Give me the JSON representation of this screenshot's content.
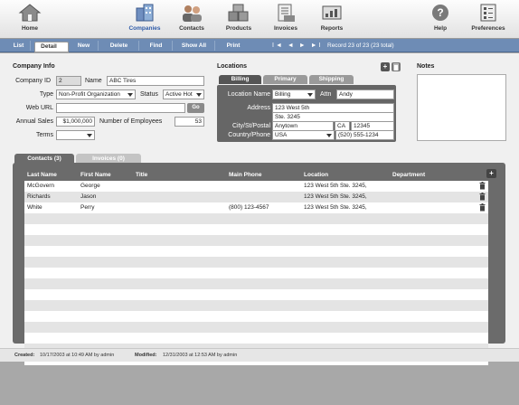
{
  "toolbar": {
    "items": [
      {
        "label": "Home",
        "icon": "house-icon"
      },
      {
        "label": "Companies",
        "icon": "buildings-icon"
      },
      {
        "label": "Contacts",
        "icon": "people-icon"
      },
      {
        "label": "Products",
        "icon": "boxes-icon"
      },
      {
        "label": "Invoices",
        "icon": "invoice-icon"
      },
      {
        "label": "Reports",
        "icon": "reports-icon"
      },
      {
        "label": "Help",
        "icon": "question-icon"
      },
      {
        "label": "Preferences",
        "icon": "preferences-icon"
      }
    ],
    "active": "Companies"
  },
  "navbar": {
    "buttons": [
      "List",
      "Detail",
      "New",
      "Delete",
      "Find",
      "Show All",
      "Print"
    ],
    "selected": "Detail",
    "record_nav": "I◄ ◄ ► ►I",
    "record_text": "Record 23 of 23 (23 total)"
  },
  "company": {
    "section_title": "Company Info",
    "id_label": "Company ID",
    "id_value": "2",
    "name_label": "Name",
    "name_value": "ABC Tires",
    "type_label": "Type",
    "type_value": "Non-Profit Organization",
    "status_label": "Status",
    "status_value": "Active Hot",
    "url_label": "Web URL",
    "url_value": "",
    "go_label": "Go",
    "sales_label": "Annual Sales",
    "sales_value": "$1,000,000",
    "employees_label": "Number of Employees",
    "employees_value": "53",
    "terms_label": "Terms",
    "terms_value": ""
  },
  "locations": {
    "section_title": "Locations",
    "tabs": [
      "Billing",
      "Primary",
      "Shipping"
    ],
    "active_tab": "Billing",
    "location_name_label": "Location Name",
    "location_name_value": "Billing",
    "attn_label": "Attn",
    "attn_value": "Andy",
    "address_label": "Address",
    "address_line1": "123 West 5th",
    "address_line2": "Ste. 3245",
    "city_label": "City/St/Postal",
    "city_value": "Anytown",
    "state_value": "CA",
    "postal_value": "12345",
    "country_label": "Country/Phone",
    "country_value": "USA",
    "phone_value": "(520) 555-1234"
  },
  "notes": {
    "label": "Notes",
    "value": ""
  },
  "portal": {
    "tabs": [
      "Contacts (3)",
      "Invoices (0)"
    ],
    "active_tab": "Contacts (3)",
    "columns": [
      "Last Name",
      "First Name",
      "Title",
      "Main Phone",
      "Location",
      "Department"
    ],
    "rows": [
      {
        "last": "McGovern",
        "first": "George",
        "title": "",
        "phone": "",
        "location": "123 West 5th Ste. 3245,",
        "department": ""
      },
      {
        "last": "Richards",
        "first": "Jason",
        "title": "",
        "phone": "",
        "location": "123 West 5th Ste. 3245,",
        "department": ""
      },
      {
        "last": "White",
        "first": "Perry",
        "title": "",
        "phone": "(800) 123-4567",
        "location": "123 West 5th Ste. 3245,",
        "department": ""
      }
    ],
    "empty_row_count": 14
  },
  "status": {
    "created_label": "Created:",
    "created_value": "10/17/2003 at 10:49 AM by admin",
    "modified_label": "Modified:",
    "modified_value": "12/31/2003 at 12:53 AM by admin"
  },
  "colors": {
    "navbar": "#6e8cb5",
    "portal_dark": "#6b6b6b",
    "active_label": "#2d5aa8",
    "row_stripe": "#e4e4e4"
  }
}
